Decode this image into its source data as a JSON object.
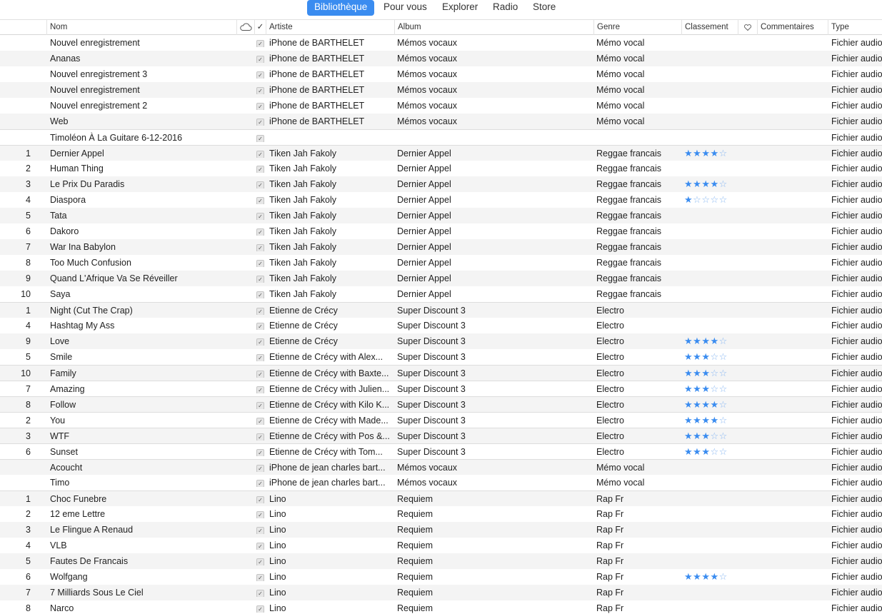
{
  "nav": {
    "tabs": [
      "Bibliothèque",
      "Pour vous",
      "Explorer",
      "Radio",
      "Store"
    ],
    "active_tab": "Bibliothèque"
  },
  "columns": {
    "name": "Nom",
    "check": "✓",
    "artist": "Artiste",
    "album": "Album",
    "genre": "Genre",
    "rating": "Classement",
    "comments": "Commentaires",
    "type": "Type"
  },
  "colors": {
    "accent": "#3a8cf0",
    "alt_row": "#f4f4f4"
  },
  "rows": [
    {
      "num": "",
      "name": "Nouvel enregistrement",
      "artist": "iPhone de BARTHELET",
      "album": "Mémos vocaux",
      "genre": "Mémo vocal",
      "rating": 0,
      "type": "Fichier audio"
    },
    {
      "num": "",
      "name": "Ananas",
      "artist": "iPhone de BARTHELET",
      "album": "Mémos vocaux",
      "genre": "Mémo vocal",
      "rating": 0,
      "type": "Fichier audio"
    },
    {
      "num": "",
      "name": "Nouvel enregistrement 3",
      "artist": "iPhone de BARTHELET",
      "album": "Mémos vocaux",
      "genre": "Mémo vocal",
      "rating": 0,
      "type": "Fichier audio"
    },
    {
      "num": "",
      "name": "Nouvel enregistrement",
      "artist": "iPhone de BARTHELET",
      "album": "Mémos vocaux",
      "genre": "Mémo vocal",
      "rating": 0,
      "type": "Fichier audio"
    },
    {
      "num": "",
      "name": "Nouvel enregistrement 2",
      "artist": "iPhone de BARTHELET",
      "album": "Mémos vocaux",
      "genre": "Mémo vocal",
      "rating": 0,
      "type": "Fichier audio"
    },
    {
      "num": "",
      "name": "Web",
      "artist": "iPhone de BARTHELET",
      "album": "Mémos vocaux",
      "genre": "Mémo vocal",
      "rating": 0,
      "type": "Fichier audio"
    },
    {
      "num": "",
      "name": "Timoléon À La Guitare 6-12-2016",
      "artist": "",
      "album": "",
      "genre": "",
      "rating": 0,
      "type": "Fichier audio",
      "sep": true
    },
    {
      "num": "1",
      "name": "Dernier Appel",
      "artist": "Tiken Jah Fakoly",
      "album": "Dernier Appel",
      "genre": "Reggae francais",
      "rating": 4,
      "type": "Fichier audio",
      "sep": true
    },
    {
      "num": "2",
      "name": "Human Thing",
      "artist": "Tiken Jah Fakoly",
      "album": "Dernier Appel",
      "genre": "Reggae francais",
      "rating": 0,
      "type": "Fichier audio"
    },
    {
      "num": "3",
      "name": "Le Prix Du Paradis",
      "artist": "Tiken Jah Fakoly",
      "album": "Dernier Appel",
      "genre": "Reggae francais",
      "rating": 4,
      "type": "Fichier audio"
    },
    {
      "num": "4",
      "name": "Diaspora",
      "artist": "Tiken Jah Fakoly",
      "album": "Dernier Appel",
      "genre": "Reggae francais",
      "rating": 1,
      "type": "Fichier audio"
    },
    {
      "num": "5",
      "name": "Tata",
      "artist": "Tiken Jah Fakoly",
      "album": "Dernier Appel",
      "genre": "Reggae francais",
      "rating": 0,
      "type": "Fichier audio"
    },
    {
      "num": "6",
      "name": "Dakoro",
      "artist": "Tiken Jah Fakoly",
      "album": "Dernier Appel",
      "genre": "Reggae francais",
      "rating": 0,
      "type": "Fichier audio"
    },
    {
      "num": "7",
      "name": "War Ina Babylon",
      "artist": "Tiken Jah Fakoly",
      "album": "Dernier Appel",
      "genre": "Reggae francais",
      "rating": 0,
      "type": "Fichier audio"
    },
    {
      "num": "8",
      "name": "Too Much Confusion",
      "artist": "Tiken Jah Fakoly",
      "album": "Dernier Appel",
      "genre": "Reggae francais",
      "rating": 0,
      "type": "Fichier audio"
    },
    {
      "num": "9",
      "name": "Quand L'Afrique Va Se Réveiller",
      "artist": "Tiken Jah Fakoly",
      "album": "Dernier Appel",
      "genre": "Reggae francais",
      "rating": 0,
      "type": "Fichier audio"
    },
    {
      "num": "10",
      "name": "Saya",
      "artist": "Tiken Jah Fakoly",
      "album": "Dernier Appel",
      "genre": "Reggae francais",
      "rating": 0,
      "type": "Fichier audio"
    },
    {
      "num": "1",
      "name": "Night (Cut The Crap)",
      "artist": "Etienne de Crécy",
      "album": "Super Discount 3",
      "genre": "Electro",
      "rating": 0,
      "type": "Fichier audio",
      "sep": true
    },
    {
      "num": "4",
      "name": "Hashtag My Ass",
      "artist": "Etienne de Crécy",
      "album": "Super Discount 3",
      "genre": "Electro",
      "rating": 0,
      "type": "Fichier audio"
    },
    {
      "num": "9",
      "name": "Love",
      "artist": "Etienne de Crécy",
      "album": "Super Discount 3",
      "genre": "Electro",
      "rating": 4,
      "type": "Fichier audio"
    },
    {
      "num": "5",
      "name": "Smile",
      "artist": "Etienne de Crécy with Alex...",
      "album": "Super Discount 3",
      "genre": "Electro",
      "rating": 3,
      "type": "Fichier audio"
    },
    {
      "num": "10",
      "name": "Family",
      "artist": "Etienne de Crécy with Baxte...",
      "album": "Super Discount 3",
      "genre": "Electro",
      "rating": 3,
      "type": "Fichier audio",
      "sep": true
    },
    {
      "num": "7",
      "name": "Amazing",
      "artist": "Etienne de Crécy with Julien...",
      "album": "Super Discount 3",
      "genre": "Electro",
      "rating": 3,
      "type": "Fichier audio",
      "sep": true
    },
    {
      "num": "8",
      "name": "Follow",
      "artist": "Etienne de Crécy with Kilo K...",
      "album": "Super Discount 3",
      "genre": "Electro",
      "rating": 4,
      "type": "Fichier audio",
      "sep": true
    },
    {
      "num": "2",
      "name": "You",
      "artist": "Etienne de Crécy with Made...",
      "album": "Super Discount 3",
      "genre": "Electro",
      "rating": 4,
      "type": "Fichier audio",
      "sep": true
    },
    {
      "num": "3",
      "name": "WTF",
      "artist": "Etienne de Crécy with Pos &...",
      "album": "Super Discount 3",
      "genre": "Electro",
      "rating": 3,
      "type": "Fichier audio",
      "sep": true
    },
    {
      "num": "6",
      "name": "Sunset",
      "artist": "Etienne de Crécy with Tom...",
      "album": "Super Discount 3",
      "genre": "Electro",
      "rating": 3,
      "type": "Fichier audio",
      "sep": true
    },
    {
      "num": "",
      "name": "Acoucht",
      "artist": "iPhone de jean charles bart...",
      "album": "Mémos vocaux",
      "genre": "Mémo vocal",
      "rating": 0,
      "type": "Fichier audio",
      "sep": true
    },
    {
      "num": "",
      "name": "Timo",
      "artist": "iPhone de jean charles bart...",
      "album": "Mémos vocaux",
      "genre": "Mémo vocal",
      "rating": 0,
      "type": "Fichier audio"
    },
    {
      "num": "1",
      "name": "Choc Funebre",
      "artist": "Lino",
      "album": "Requiem",
      "genre": "Rap Fr",
      "rating": 0,
      "type": "Fichier audio",
      "sep": true
    },
    {
      "num": "2",
      "name": "12 eme Lettre",
      "artist": "Lino",
      "album": "Requiem",
      "genre": "Rap Fr",
      "rating": 0,
      "type": "Fichier audio"
    },
    {
      "num": "3",
      "name": "Le Flingue A Renaud",
      "artist": "Lino",
      "album": "Requiem",
      "genre": "Rap Fr",
      "rating": 0,
      "type": "Fichier audio"
    },
    {
      "num": "4",
      "name": "VLB",
      "artist": "Lino",
      "album": "Requiem",
      "genre": "Rap Fr",
      "rating": 0,
      "type": "Fichier audio"
    },
    {
      "num": "5",
      "name": "Fautes De Francais",
      "artist": "Lino",
      "album": "Requiem",
      "genre": "Rap Fr",
      "rating": 0,
      "type": "Fichier audio"
    },
    {
      "num": "6",
      "name": "Wolfgang",
      "artist": "Lino",
      "album": "Requiem",
      "genre": "Rap Fr",
      "rating": 4,
      "type": "Fichier audio"
    },
    {
      "num": "7",
      "name": "7 Milliards Sous Le Ciel",
      "artist": "Lino",
      "album": "Requiem",
      "genre": "Rap Fr",
      "rating": 0,
      "type": "Fichier audio"
    },
    {
      "num": "8",
      "name": "Narco",
      "artist": "Lino",
      "album": "Requiem",
      "genre": "Rap Fr",
      "rating": 0,
      "type": "Fichier audio"
    }
  ]
}
